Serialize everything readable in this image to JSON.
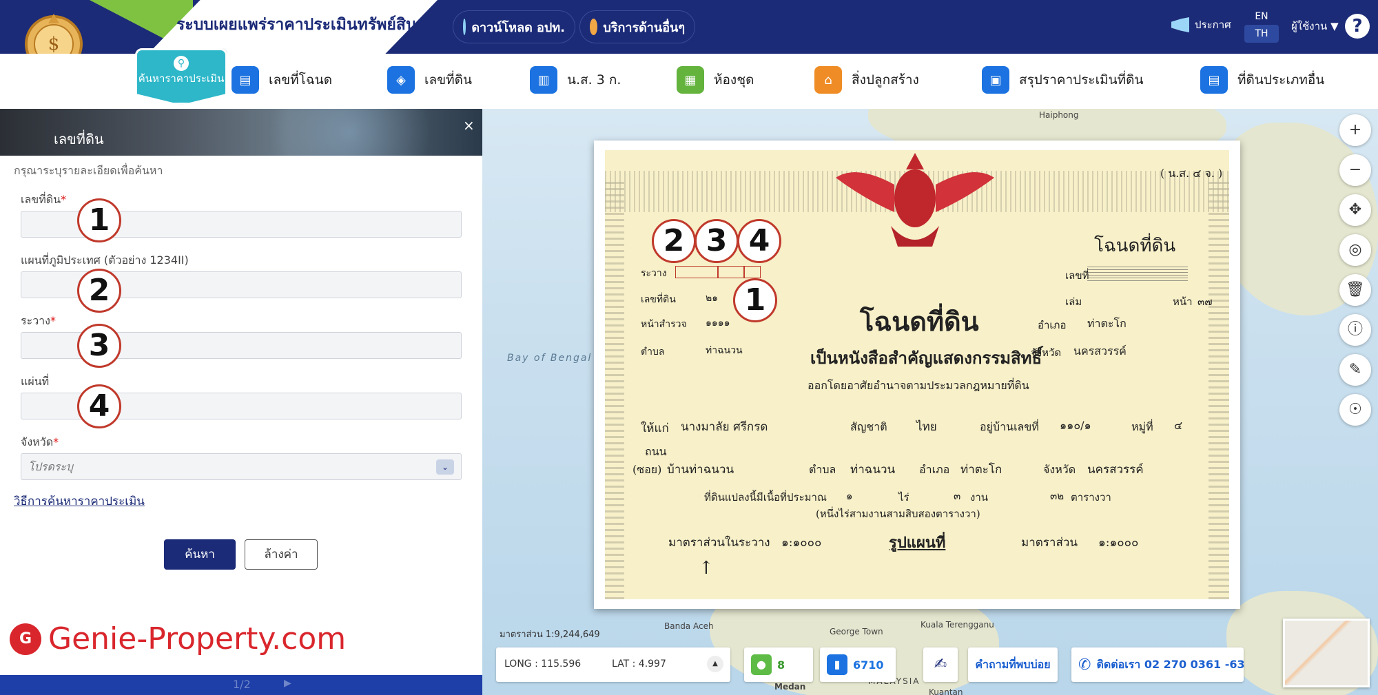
{
  "header": {
    "site_title": "ระบบเผยแพร่ราคาประเมินทรัพย์สิน",
    "download_label": "ดาวน์โหลด อปท.",
    "services_label": "บริการด้านอื่นๆ",
    "announce_label": "ประกาศ",
    "lang_en": "EN",
    "lang_th": "TH",
    "user_label": "ผู้ใช้งาน",
    "help_label": "?"
  },
  "nav": {
    "search_badge": "ค้นหาราคาประเมิน",
    "items": [
      {
        "label": "เลขที่โฉนด",
        "icon": "document-icon"
      },
      {
        "label": "เลขที่ดิน",
        "icon": "layers-icon"
      },
      {
        "label": "น.ส. 3 ก.",
        "icon": "map-icon"
      },
      {
        "label": "ห้องชุด",
        "icon": "building-icon"
      },
      {
        "label": "สิ่งปลูกสร้าง",
        "icon": "house-icon"
      },
      {
        "label": "สรุปราคาประเมินที่ดิน",
        "icon": "summary-icon"
      },
      {
        "label": "ที่ดินประเภทอื่น",
        "icon": "other-land-icon"
      }
    ]
  },
  "panel": {
    "title": "เลขที่ดิน",
    "close": "×",
    "hint": "กรุณาระบุรายละเอียดเพื่อค้นหา",
    "fields": [
      {
        "label": "เลขที่ดิน",
        "required": "*"
      },
      {
        "label": "แผนที่ภูมิประเทศ (ตัวอย่าง 1234II)",
        "required": ""
      },
      {
        "label": "ระวาง",
        "required": "*"
      },
      {
        "label": "แผ่นที่",
        "required": ""
      }
    ],
    "province_label": "จังหวัด",
    "province_required": "*",
    "province_placeholder": "โปรดระบุ",
    "howto_link": "วิธีการค้นหาราคาประเมิน",
    "search_button": "ค้นหา",
    "clear_button": "ล้างค่า",
    "pager": "1/2"
  },
  "annotations": [
    "1",
    "2",
    "3",
    "4"
  ],
  "watermark": "Genie-Property.com",
  "map": {
    "labels": {
      "haiphong": "Haiphong",
      "bay_of_bengal": "Bay of Bengal",
      "banda_aceh": "Banda Aceh",
      "george_town": "George Town",
      "kuala_terengganu": "Kuala Terengganu",
      "medan": "Medan",
      "malaysia": "MALAYSIA",
      "kuantan": "Kuantan"
    },
    "scale": "มาตราส่วน 1:9,244,649",
    "long": "LONG : 115.596",
    "lat": "LAT : 4.997",
    "users_count": "8",
    "views_count": "6710",
    "faq_label": "คำถามที่พบบ่อย",
    "contact_label": "ติดต่อเรา 02 270 0361 -63"
  },
  "deed": {
    "form_code": "( น.ส. ๔ จ. )",
    "heading_small": "โฉนดที่ดิน",
    "no_label": "เลขที่",
    "book_label": "เล่ม",
    "page_label": "หน้า",
    "page_value": "๓๗",
    "district_label": "อำเภอ",
    "district_value": "ท่าตะโก",
    "province_label": "จังหวัด",
    "province_value": "นครสวรรค์",
    "rawang_label": "ระวาง",
    "land_no_label": "เลขที่ดิน",
    "land_no_value": "๒๑",
    "survey_page_label": "หน้าสำรวจ",
    "survey_page_value": "๑๑๑๑",
    "tambon_label": "ตำบล",
    "tambon_value": "ท่าฉนวน",
    "big_title": "โฉนดที่ดิน",
    "subtitle": "เป็นหนังสือสำคัญแสดงกรรมสิทธิ์",
    "authority": "ออกโดยอาศัยอำนาจตามประมวลกฎหมายที่ดิน",
    "issued_to": "ให้แก่",
    "owner": "นางมาลัย ศรีกรด",
    "nationality_label": "สัญชาติ",
    "nationality": "ไทย",
    "address_label": "อยู่บ้านเลขที่",
    "address_no": "๑๑๐/๑",
    "moo_label": "หมู่ที่",
    "moo_value": "๔",
    "road_label": "ถนน",
    "soi_label": "(ซอย)",
    "soi_value": "บ้านท่าฉนวน",
    "area_text": "ที่ดินแปลงนี้มีเนื้อที่ประมาณ",
    "area_rai": "๑",
    "area_ngan": "๓",
    "area_wa": "๓๒",
    "rai_label": "ไร่",
    "ngan_label": "งาน",
    "wa_label": "ตารางวา",
    "area_words": "(หนึ่งไร่สามงานสามสิบสองตารางวา)",
    "scale_label": "มาตราส่วนในระวาง",
    "scale_value": "๑:๑๐๐๐",
    "map_label": "รูปแผนที่",
    "scale_label2": "มาตราส่วน",
    "scale_value2": "๑:๑๐๐๐"
  },
  "colors": {
    "header_bg": "#1c2b77",
    "accent_teal": "#2db7c9",
    "link_blue": "#1c2b77",
    "annotation_red": "#c0392b",
    "watermark_red": "#d9262c"
  }
}
